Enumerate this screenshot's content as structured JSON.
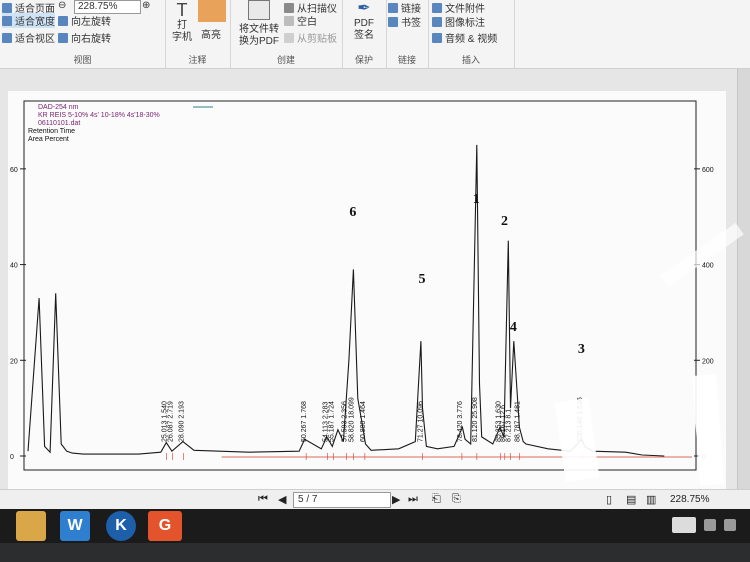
{
  "ribbon": {
    "view": {
      "fit_page": "适合页面",
      "fit_width": "适合宽度",
      "fit_view": "适合视区",
      "zoom": "228.75%",
      "rotate_left": "向左旋转",
      "rotate_right": "向右旋转",
      "group": "视图"
    },
    "annotate": {
      "typewriter_1": "打",
      "typewriter_2": "字机",
      "highlight": "高亮",
      "group": "注释"
    },
    "create": {
      "convert_1": "将文件转",
      "convert_2": "换为PDF",
      "from_scanner": "从扫描仪",
      "blank": "空白",
      "from_clipboard": "从剪贴板",
      "group": "创建"
    },
    "protect": {
      "pdf_sign_1": "PDF",
      "pdf_sign_2": "签名",
      "group": "保护"
    },
    "links": {
      "link": "链接",
      "bookmark": "书签",
      "group": "链接"
    },
    "insert": {
      "attachment": "文件附件",
      "image_annotation": "图像标注",
      "audio_video": "音频 & 视频",
      "group": "插入"
    }
  },
  "chart_data": {
    "type": "line",
    "header_lines": [
      "DAD-254 nm",
      "KR REIS 5-10% 4s' 10-18% 4s'18-30%",
      "06110101.dat",
      "Retention Time",
      "Area Percent"
    ],
    "left_axis_ticks": [
      0,
      20,
      40,
      60
    ],
    "right_axis_ticks": [
      0,
      200,
      400,
      600
    ],
    "ylim": [
      0,
      700
    ],
    "xlim": [
      0,
      120
    ],
    "series": [
      {
        "x": [
          0,
          2,
          3,
          4,
          5,
          6,
          7,
          8,
          10,
          20,
          24,
          25,
          26,
          28,
          30,
          40,
          49,
          50,
          53,
          54,
          55,
          56,
          57,
          58,
          58.8,
          59.6,
          60.5,
          61,
          62,
          67,
          70,
          71,
          71.3,
          72,
          74,
          77,
          78.5,
          79,
          80,
          81.1,
          81.6,
          82,
          84,
          85.3,
          86,
          86.8,
          87.2,
          87.8,
          88.8,
          89.5,
          90,
          94,
          98,
          100.1,
          100.6,
          102,
          108,
          111,
          115
        ],
        "y": [
          10,
          330,
          20,
          8,
          340,
          25,
          10,
          6,
          4,
          4,
          8,
          28,
          10,
          30,
          12,
          8,
          10,
          35,
          15,
          40,
          20,
          55,
          30,
          200,
          390,
          120,
          60,
          25,
          12,
          15,
          30,
          240,
          100,
          20,
          15,
          20,
          60,
          35,
          25,
          650,
          150,
          40,
          25,
          60,
          40,
          450,
          100,
          240,
          60,
          30,
          25,
          15,
          10,
          35,
          20,
          10,
          8,
          2,
          0
        ]
      }
    ],
    "peak_labels": [
      {
        "x": 25.013,
        "label": "25.013  1.540"
      },
      {
        "x": 26.087,
        "label": "26.087  2.719"
      },
      {
        "x": 28.09,
        "label": "28.090  2.193"
      },
      {
        "x": 50.267,
        "label": "50.267  1.768"
      },
      {
        "x": 54.113,
        "label": "54.113  2.283"
      },
      {
        "x": 55.187,
        "label": "55.187  1.724"
      },
      {
        "x": 57.593,
        "label": "57.593  2.356"
      },
      {
        "x": 58.82,
        "label": "58.820  18.099"
      },
      {
        "x": 60.88,
        "label": "60.880  1.464"
      },
      {
        "x": 71.27,
        "label": "71.27  10.096"
      },
      {
        "x": 78.42,
        "label": "78.420  3.776"
      },
      {
        "x": 81.12,
        "label": "81.120  25.908"
      },
      {
        "x": 85.353,
        "label": "85.353  1.630"
      },
      {
        "x": 86.167,
        "label": "86.167  12.6"
      },
      {
        "x": 87.213,
        "label": "87.213  8.1"
      },
      {
        "x": 88.787,
        "label": "88.787  1.481"
      },
      {
        "x": 100.14,
        "label": "100.140  1.616"
      }
    ],
    "handwritten_marks": [
      {
        "x": 58.8,
        "label": "6"
      },
      {
        "x": 71.3,
        "label": "5"
      },
      {
        "x": 81.1,
        "label": "1"
      },
      {
        "x": 86.2,
        "label": "2"
      },
      {
        "x": 87.8,
        "label": "4"
      },
      {
        "x": 100.1,
        "label": "3"
      }
    ],
    "trace_color": "#1a1a1a",
    "baseline_color": "#d23a2a",
    "grid": false
  },
  "status": {
    "page": "5 / 7",
    "zoom": "228.75%"
  }
}
